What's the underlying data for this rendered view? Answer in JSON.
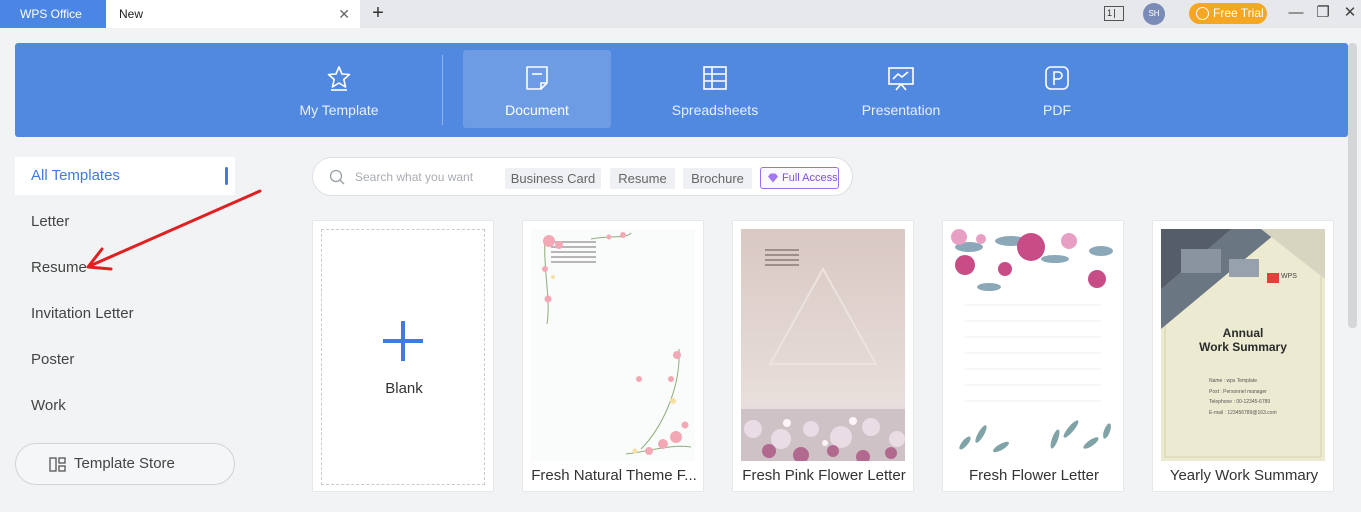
{
  "titlebar": {
    "app_tab": "WPS Office",
    "doc_tab": "New",
    "close_glyph": "✕",
    "add_glyph": "+",
    "window_icon_text": "1",
    "avatar_initials": "SH",
    "trial_label": "Free Trial",
    "minimize_glyph": "—",
    "restore_glyph": "❐",
    "close_window_glyph": "✕"
  },
  "categories": [
    {
      "label": "My Template",
      "icon": "star-template-icon"
    },
    {
      "label": "Document",
      "icon": "document-icon",
      "active": true
    },
    {
      "label": "Spreadsheets",
      "icon": "spreadsheet-icon"
    },
    {
      "label": "Presentation",
      "icon": "presentation-icon"
    },
    {
      "label": "PDF",
      "icon": "pdf-icon"
    }
  ],
  "sidebar": {
    "items": [
      {
        "label": "All Templates",
        "active": true
      },
      {
        "label": "Letter"
      },
      {
        "label": "Resume"
      },
      {
        "label": "Invitation Letter"
      },
      {
        "label": "Poster"
      },
      {
        "label": "Work"
      }
    ],
    "store_label": "Template Store"
  },
  "search": {
    "placeholder": "Search what you want",
    "chips": [
      "Business Card",
      "Resume",
      "Brochure"
    ],
    "full_access": "Full Access"
  },
  "cards": {
    "blank": "Blank",
    "items": [
      {
        "label": "Fresh Natural Theme F..."
      },
      {
        "label": "Fresh Pink Flower Letter"
      },
      {
        "label": "Fresh Flower Letter"
      },
      {
        "label": "Yearly Work Summary"
      }
    ]
  },
  "summary_thumb": {
    "brand": "WPS",
    "heading_line1": "Annual",
    "heading_line2": "Work Summary",
    "fields": [
      "Name : wps Template",
      "Post : Personnel manager",
      "Telephone : 00-12345-6789",
      "E-mail : 123456789@163.com"
    ]
  },
  "colors": {
    "accent": "#5289e0",
    "active_text": "#3f7be0",
    "trial": "#f5a623",
    "annotation_arrow": "#e02020"
  }
}
